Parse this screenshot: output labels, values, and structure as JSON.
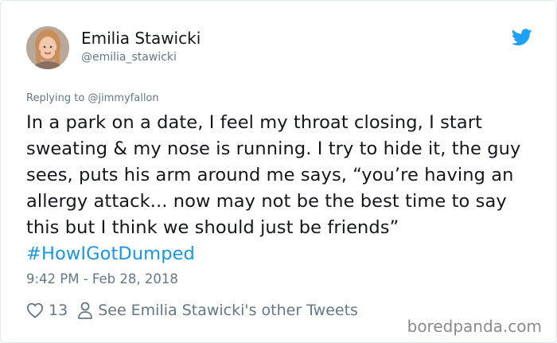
{
  "user": {
    "name": "Emilia Stawicki",
    "handle": "@emilia_stawicki"
  },
  "tweet": {
    "replying_to": "Replying to @jimmyfallon",
    "text_before_hashtag": "In a park on a date, I feel my throat closing, I start sweating & my nose is running. I try to hide it, the guy sees, puts his arm around me says, “you’re having an allergy attack... now may not be the best time to say this but I think we should just be friends”",
    "hashtag": "#HowIGotDumped",
    "timestamp": "9:42 PM - Feb 28, 2018",
    "like_count": "13",
    "other_tweets_link": "See Emilia Stawicki's other Tweets"
  },
  "watermark": "boredpanda.com",
  "icons": {
    "brand": "twitter-bird-icon",
    "like": "heart-icon",
    "profile": "person-icon"
  },
  "colors": {
    "twitter_blue": "#1da1f2",
    "hashtag": "#1b95e0",
    "secondary_text": "#657786",
    "primary_text": "#14171a"
  }
}
